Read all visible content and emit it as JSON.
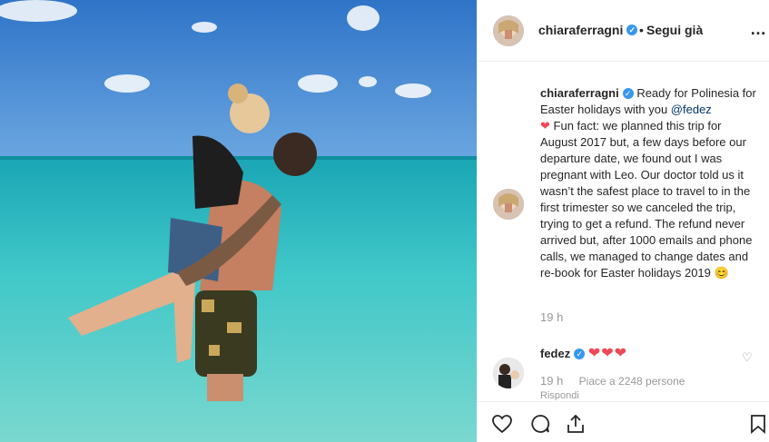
{
  "post": {
    "username": "chiaraferragni",
    "verified_mark": "✓",
    "dot": "•",
    "follow_label": "Segui già",
    "more_icon": "…"
  },
  "caption": {
    "username": "chiaraferragni",
    "text_1": " Ready for Polinesia for Easter holidays with you ",
    "mention": "@fedez",
    "heart": "❤",
    "text_2": " Fun fact: we planned this trip for August 2017 but, a few days before our departure date, we found out I was pregnant with Leo. Our doctor told us it wasn’t the safest place to travel to in the first trimester so we canceled the trip, trying to get a refund. The refund never arrived but, after 1000 emails and phone calls, we managed to change dates and re-book for Easter holidays 2019 ",
    "emoji": "😊",
    "time": "19 h"
  },
  "comment": {
    "username": "fedez",
    "hearts": "❤❤❤",
    "time": "19 h",
    "likes": "Piace a 2248 persone",
    "reply": "Rispondi",
    "like_icon": "♡"
  },
  "icons": [
    "heart-outline-icon",
    "comment-icon",
    "share-icon",
    "bookmark-icon"
  ],
  "colors": {
    "verified": "#3897f0",
    "heart": "#ed4956",
    "muted": "#999999",
    "mention": "#003569"
  }
}
